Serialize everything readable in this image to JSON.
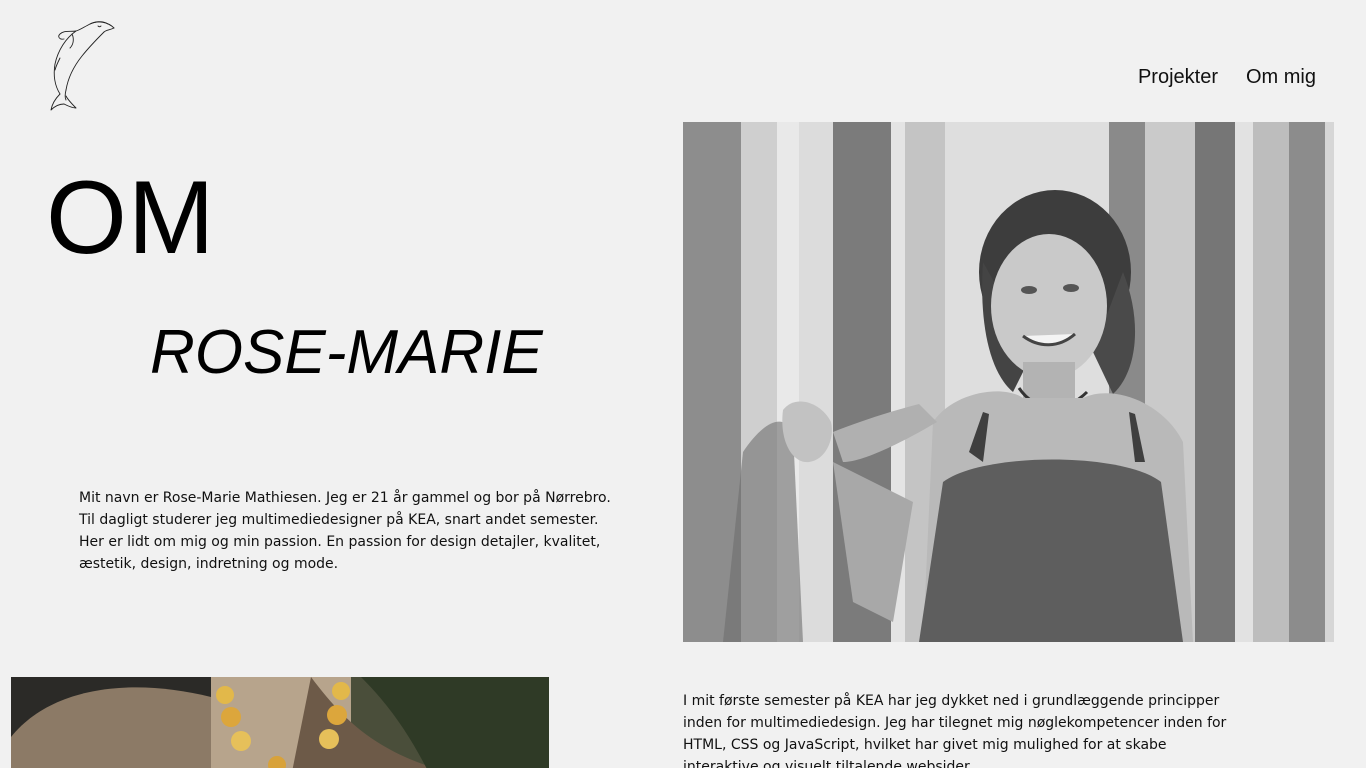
{
  "nav": {
    "items": [
      {
        "label": "Projekter"
      },
      {
        "label": "Om mig"
      }
    ]
  },
  "hero": {
    "title": "OM",
    "subtitle": "ROSE-MARIE"
  },
  "intro": {
    "text": "Mit navn er Rose-Marie Mathiesen. Jeg er 21 år gammel og bor på Nørrebro. Til dagligt studerer jeg multimediedesigner på KEA, snart andet semester. Her er lidt om mig og min passion. En passion for design detajler, kvalitet, æstetik, design, indretning og mode."
  },
  "study": {
    "text": "I mit første semester på KEA har jeg dykket ned i grundlæggende principper inden for multimediedesign. Jeg har tilegnet mig nøglekompetencer inden for HTML, CSS og JavaScript, hvilket har givet mig mulighed for at skabe interaktive og visuelt tiltalende websider."
  },
  "icons": {
    "logo": "dolphin-logo-icon"
  },
  "colors": {
    "background": "#f1f1f1",
    "text": "#000000"
  }
}
